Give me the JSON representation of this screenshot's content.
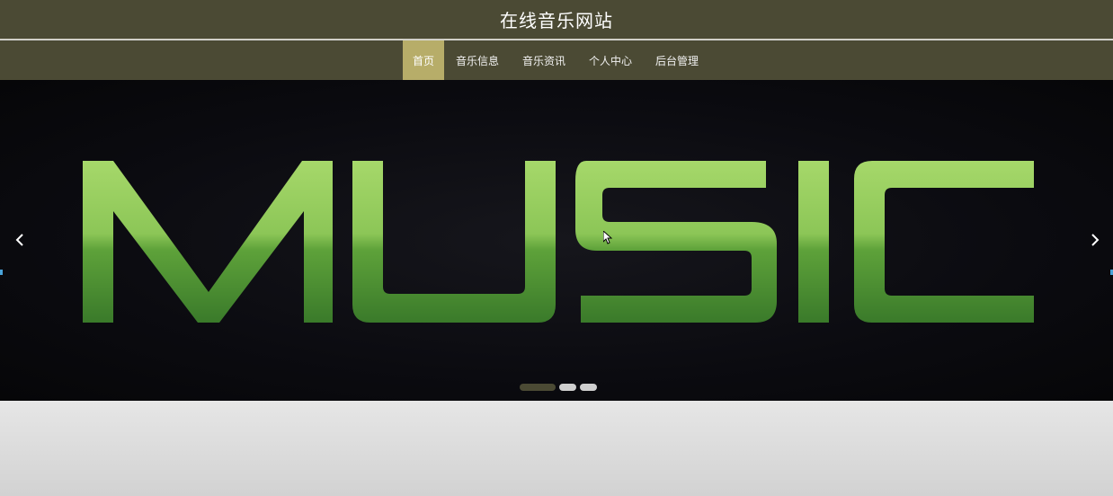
{
  "site": {
    "title": "在线音乐网站"
  },
  "nav": {
    "items": [
      {
        "label": "首页",
        "active": true
      },
      {
        "label": "音乐信息",
        "active": false
      },
      {
        "label": "音乐资讯",
        "active": false
      },
      {
        "label": "个人中心",
        "active": false
      },
      {
        "label": "后台管理",
        "active": false
      }
    ]
  },
  "banner": {
    "image_text": "MUSIC",
    "slide_count": 3,
    "active_slide": 1,
    "prev_icon": "chevron-left-icon",
    "next_icon": "chevron-right-icon"
  },
  "colors": {
    "header_bg": "#4b4a34",
    "nav_active_bg": "#b7ad69",
    "banner_bg": "#0b0b10",
    "music_green_top": "#a6d86a",
    "music_green_bottom": "#3a7a2a"
  }
}
